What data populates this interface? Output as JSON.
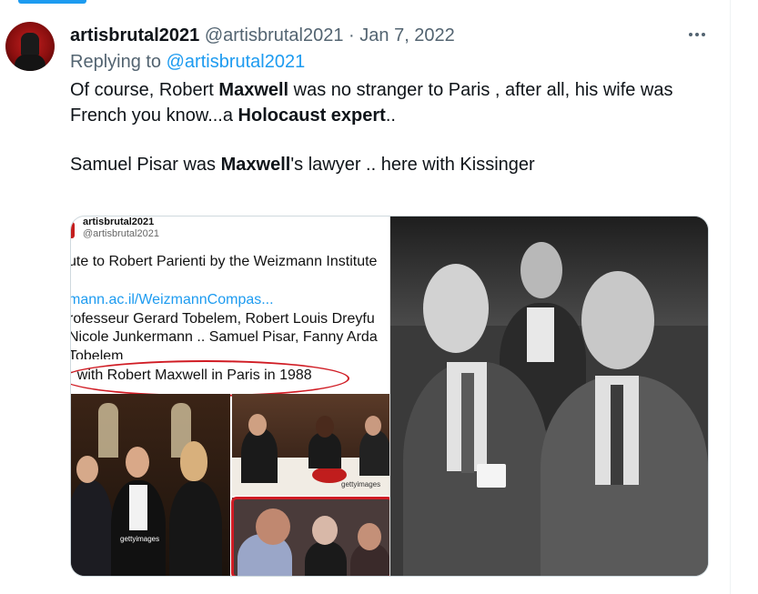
{
  "tweet": {
    "display_name": "artisbrutal2021",
    "handle": "@artisbrutal2021",
    "separator": "·",
    "date": "Jan 7, 2022",
    "replying_prefix": "Replying to",
    "replying_to": "@artisbrutal2021",
    "text": {
      "line1_a": "Of course, Robert ",
      "line1_b": "Maxwell",
      "line1_c": " was no stranger to Paris , after all, his wife was",
      "line2_a": "French you know...a ",
      "line2_b": "Holocaust expert",
      "line2_c": "..",
      "line3_a": "Samuel Pisar was ",
      "line3_b": "Maxwell",
      "line3_c": "'s lawyer .. here with Kissinger"
    }
  },
  "media": {
    "embedded_tweet": {
      "name": "artisbrutal2021",
      "handle": "@artisbrutal2021",
      "line1": "ute to Robert Parienti by the Weizmann Institute",
      "line2": "mann.ac.il/WeizmannCompas...",
      "line3": "rofesseur Gerard Tobelem, Robert Louis Dreyfu",
      "line4": "Nicole Junkermann .. Samuel Pisar, Fanny Arda",
      "line5": "Tobelem",
      "line6": "r with  Robert Maxwell in Paris in 1988"
    },
    "watermarks": {
      "getty_a": "gettyimages",
      "getty_b": "gettyimages"
    }
  },
  "colors": {
    "accent": "#1d9bf0",
    "secondary_text": "#536471",
    "annotation_red": "#d01c24"
  },
  "icons": {
    "more": "more-horizontal-icon"
  }
}
